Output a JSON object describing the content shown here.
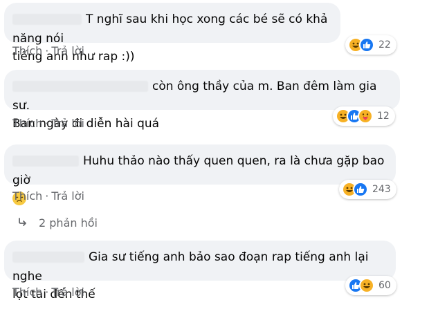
{
  "comments": [
    {
      "text_line1": "T nghĩ sau khi học xong các bé sẽ có khả năng nói",
      "text_line2": "tiếng anh như rap :))",
      "reactions": [
        "haha",
        "like"
      ],
      "count": "22"
    },
    {
      "text_line1": "còn ông thầy của m. Ban đêm làm gia sư.",
      "text_line2": "Ban ngày đi diễn hài quá",
      "reactions": [
        "haha",
        "like",
        "care"
      ],
      "count": "12"
    },
    {
      "text_line1": "Huhu thảo nào thấy quen quen, ra là chưa gặp bao giờ",
      "reactions": [
        "haha",
        "like"
      ],
      "count": "243"
    },
    {
      "text_line1": "Gia sư tiếng anh bảo sao đoạn rap tiếng anh lại nghe",
      "text_line2": "lọt tai đến thế",
      "reactions": [
        "like",
        "haha"
      ],
      "count": "60"
    }
  ],
  "actions": {
    "like": "Thích",
    "reply": "Trả lời",
    "separator": "·"
  },
  "replies": {
    "label": "2 phản hồi",
    "icon": "reply-arrow-icon"
  },
  "colors": {
    "bubble": "#f0f2f5",
    "meta": "#65676b",
    "like_blue": "#1877f2",
    "haha_yellow": "#f7b125"
  }
}
